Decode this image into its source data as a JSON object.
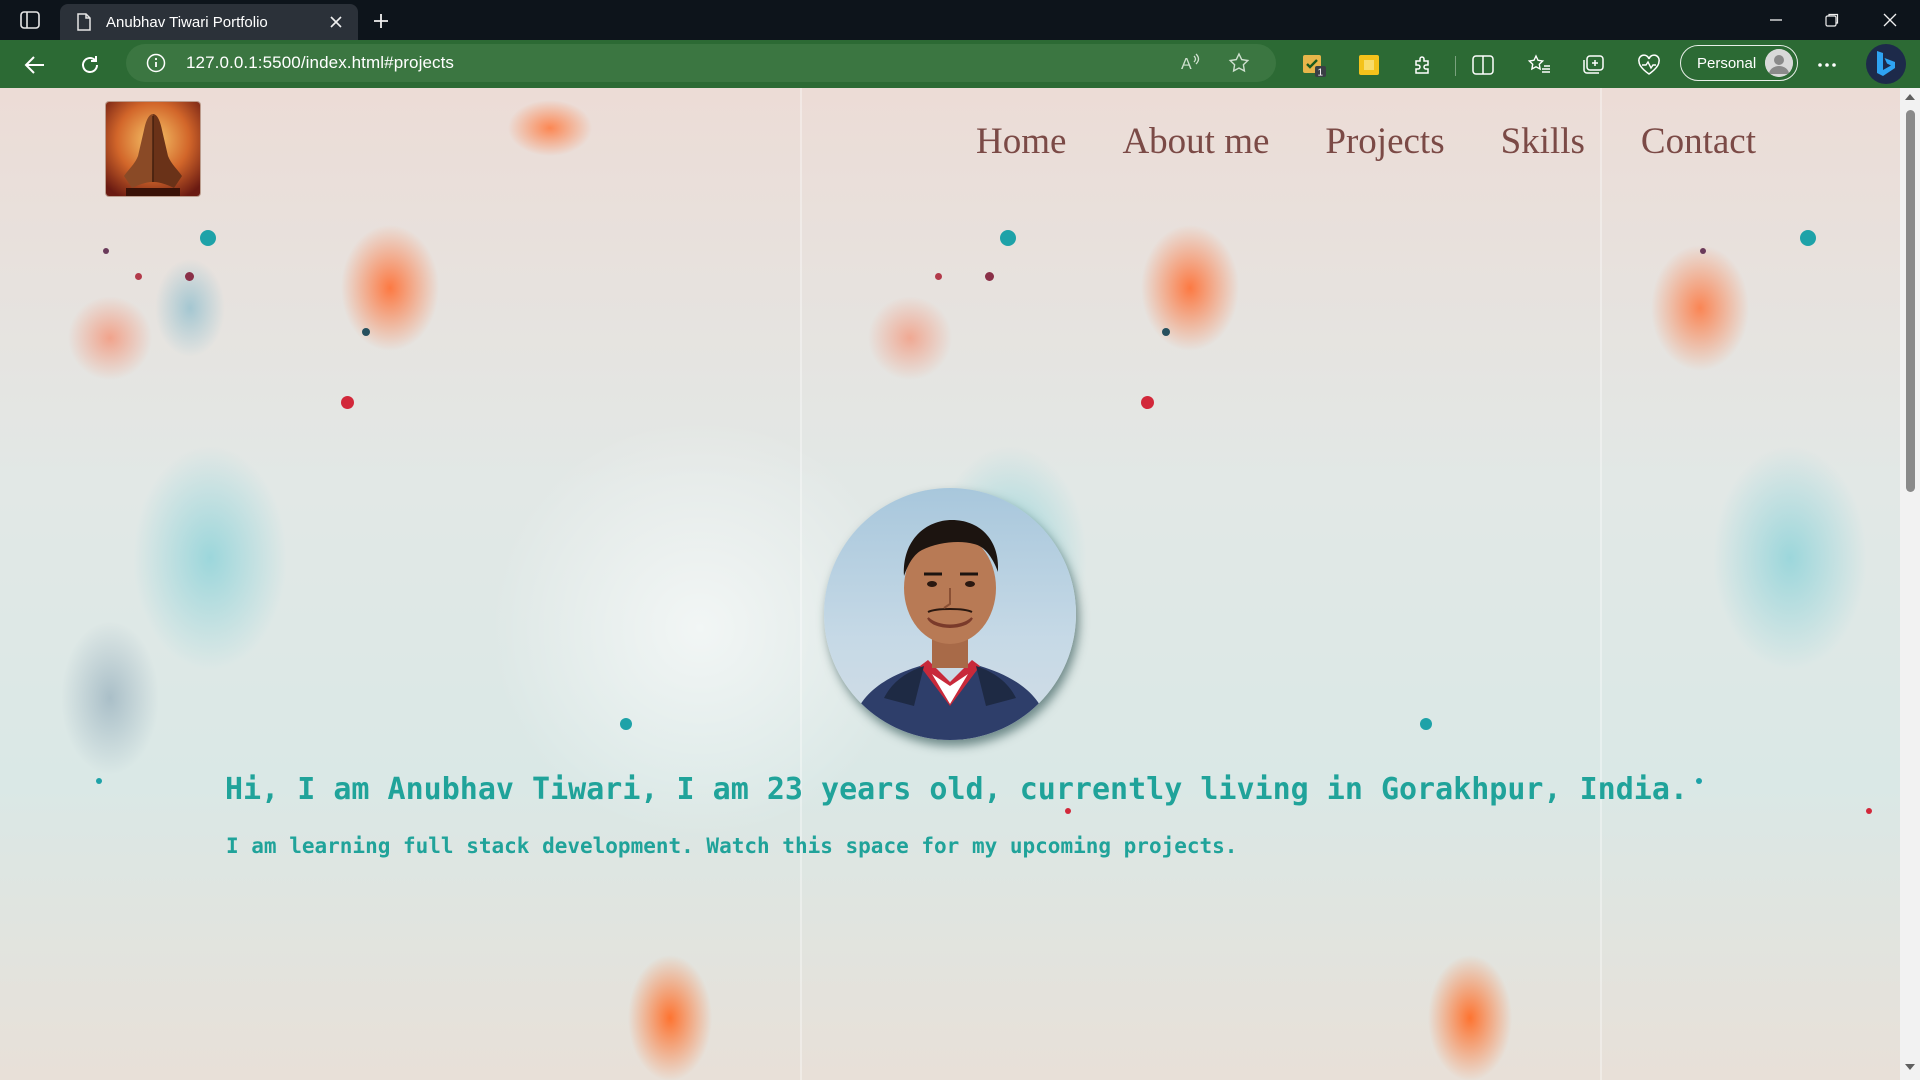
{
  "browser": {
    "tab_title": "Anubhav Tiwari Portfolio",
    "url": "127.0.0.1:5500/index.html#projects",
    "profile_label": "Personal",
    "icons": [
      "tab-actions-icon",
      "page-icon",
      "close-icon",
      "new-tab-icon",
      "minimize-icon",
      "restore-icon",
      "window-close-icon",
      "back-icon",
      "refresh-icon",
      "info-icon",
      "read-aloud-icon",
      "favorite-star-icon",
      "extension-checklist-icon",
      "extension-note-icon",
      "extensions-puzzle-icon",
      "split-screen-icon",
      "favorites-icon",
      "collections-icon",
      "browser-essentials-icon",
      "more-icon",
      "bing-copilot-icon"
    ],
    "extension_badge": "1",
    "colors": {
      "titlebar": "#0d141b",
      "toolbar": "#2c6a34",
      "addressbar": "#3b7641"
    }
  },
  "site": {
    "nav": [
      {
        "label": "Home"
      },
      {
        "label": "About me"
      },
      {
        "label": "Projects"
      },
      {
        "label": "Skills"
      },
      {
        "label": "Contact"
      }
    ],
    "intro": {
      "line1": "Hi, I am Anubhav Tiwari, I am 23 years old, currently living in Gorakhpur, India.",
      "line2": "I am learning full stack development. Watch this space for my upcoming projects."
    },
    "colors": {
      "nav_text": "#7b4a46",
      "intro_text": "#20a39a"
    }
  }
}
